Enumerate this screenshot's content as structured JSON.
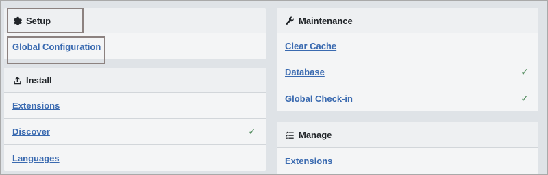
{
  "setup": {
    "title": "Setup",
    "icon": "gear-icon",
    "items": [
      {
        "label": "Global Configuration",
        "checked": false
      }
    ]
  },
  "install": {
    "title": "Install",
    "icon": "upload-icon",
    "items": [
      {
        "label": "Extensions",
        "checked": false
      },
      {
        "label": "Discover",
        "checked": true
      },
      {
        "label": "Languages",
        "checked": false
      }
    ]
  },
  "maintenance": {
    "title": "Maintenance",
    "icon": "wrench-icon",
    "items": [
      {
        "label": "Clear Cache",
        "checked": false
      },
      {
        "label": "Database",
        "checked": true
      },
      {
        "label": "Global Check-in",
        "checked": true
      }
    ]
  },
  "manage": {
    "title": "Manage",
    "icon": "checklist-icon",
    "items": [
      {
        "label": "Extensions",
        "checked": false
      }
    ]
  },
  "colors": {
    "link": "#3a6ab0",
    "check": "#4f8a5b",
    "panel_bg": "#dfe3e7",
    "card_bg": "#eef0f2"
  }
}
